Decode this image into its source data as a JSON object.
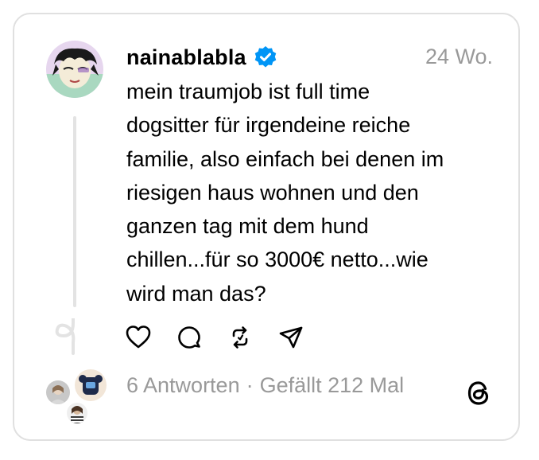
{
  "post": {
    "username": "nainablabla",
    "timestamp": "24 Wo.",
    "text": "mein traumjob ist full time\ndogsitter für irgendeine reiche\nfamilie, also einfach bei denen im\nriesigen haus wohnen und den\nganzen tag mit dem hund\nchillen...für so 3000€ netto...wie\nwird man das?"
  },
  "stats": {
    "replies": "6 Antworten",
    "separator": "·",
    "likes": "Gefällt 212 Mal"
  },
  "icons": {
    "verified": "verified-badge-icon",
    "like": "heart-icon",
    "reply": "comment-bubble-icon",
    "repost": "repost-icon",
    "share": "send-icon",
    "brand": "threads-logo-icon"
  },
  "colors": {
    "verified_blue": "#0095f6",
    "muted_text": "#999999",
    "border": "#e0e0e0"
  }
}
